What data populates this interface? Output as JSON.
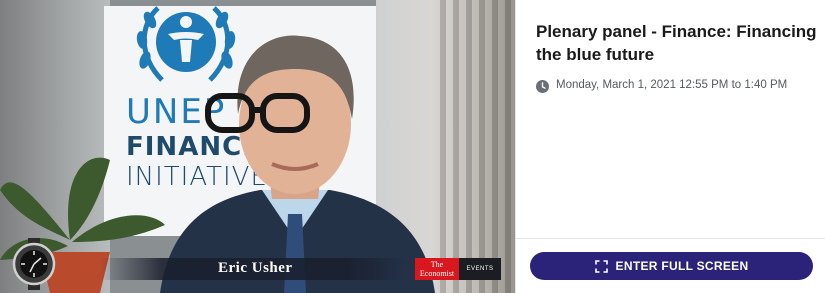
{
  "video": {
    "speaker_name": "Eric Usher",
    "banner": {
      "line1": "UNEP",
      "line2": "FINANCE",
      "line3": "INITIATIVE"
    },
    "logos": {
      "economist_line1": "The",
      "economist_line2": "Economist",
      "events_label": "EVENTS"
    }
  },
  "session": {
    "title": "Plenary panel - Finance: Financing the blue future",
    "datetime": "Monday, March 1, 2021 12:55 PM to 1:40 PM",
    "clock_icon": "clock-icon"
  },
  "actions": {
    "fullscreen_label": "ENTER FULL SCREEN",
    "fullscreen_icon": "expand-corners-icon"
  },
  "colors": {
    "accent": "#2a2379",
    "unep_blue": "#1e7bb8",
    "economist_red": "#d8171e"
  }
}
